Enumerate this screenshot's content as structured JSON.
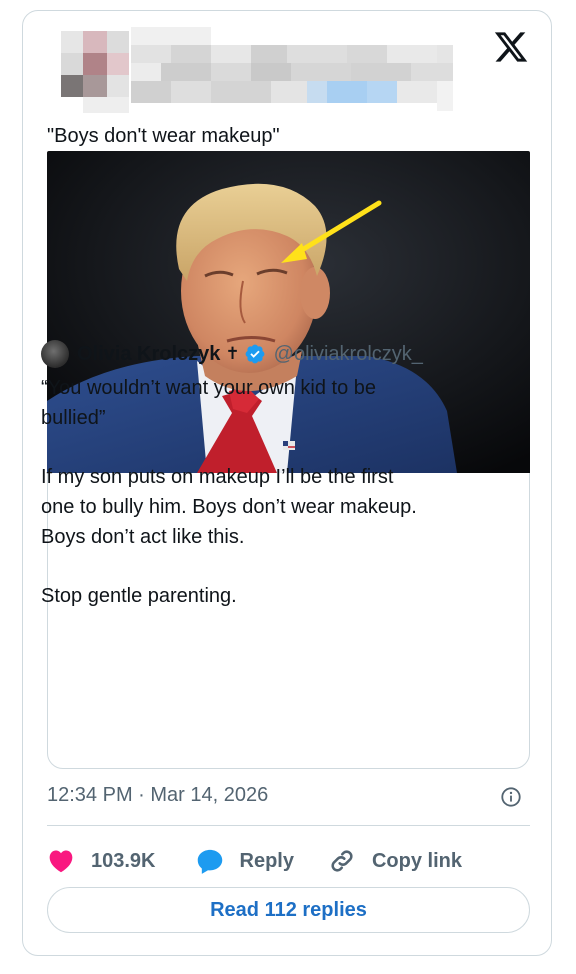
{
  "tweet": {
    "text": "\"Boys don't wear makeup\"",
    "timestamp": "12:34 PM · Mar 14, 2026"
  },
  "quoted": {
    "name": "Olivia Krolczyk",
    "name_symbol": "✝",
    "handle": "@oliviakrolczyk_",
    "lines": [
      "“You wouldn’t want your own kid to be",
      "bullied”",
      "",
      "If my son puts on makeup I’ll be the first",
      "one to bully him. Boys don’t wear makeup.",
      "Boys don’t act like this.",
      "",
      "Stop gentle parenting."
    ]
  },
  "actions": {
    "like_count": "103.9K",
    "reply_label": "Reply",
    "copy_label": "Copy link"
  },
  "read_replies": "Read 112 replies",
  "colors": {
    "like": "#f91880",
    "reply": "#1d9bf0",
    "link_text": "#1d6fc5",
    "arrow": "#ffe11a",
    "verified": "#1d9bf0"
  },
  "icons": [
    "x-logo-icon",
    "verified-badge-icon",
    "info-icon",
    "heart-icon",
    "reply-bubble-icon",
    "link-icon"
  ]
}
